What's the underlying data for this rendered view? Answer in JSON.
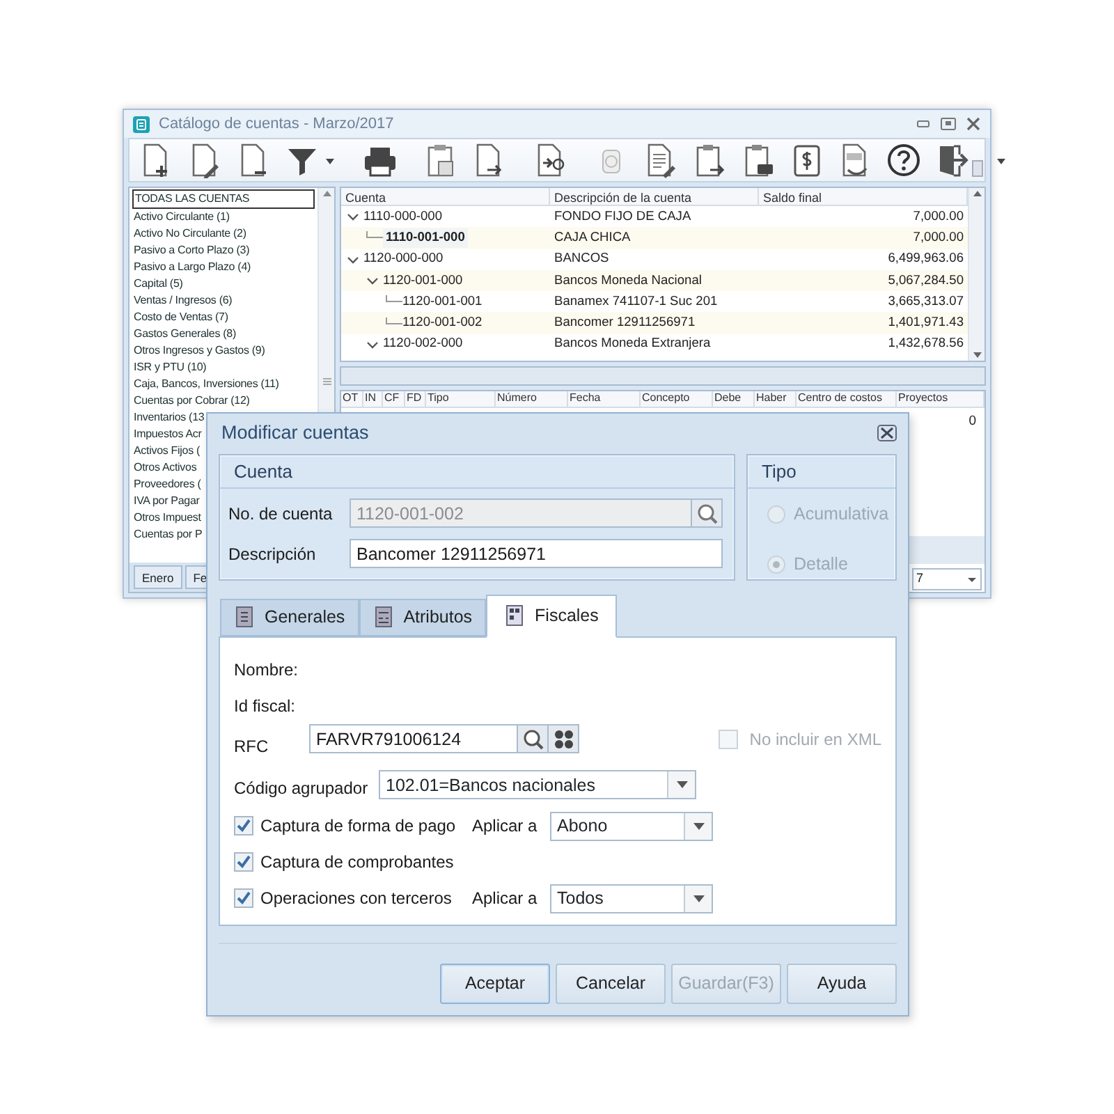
{
  "window": {
    "title": "Catálogo de cuentas - Marzo/2017"
  },
  "categories": [
    {
      "label": "TODAS LAS CUENTAS",
      "selected": true
    },
    {
      "label": "Activo Circulante (1)",
      "selected": false
    },
    {
      "label": "Activo No Circulante (2)",
      "selected": false
    },
    {
      "label": "Pasivo a Corto Plazo (3)",
      "selected": false
    },
    {
      "label": "Pasivo a Largo Plazo (4)",
      "selected": false
    },
    {
      "label": "Capital (5)",
      "selected": false
    },
    {
      "label": "Ventas / Ingresos (6)",
      "selected": false
    },
    {
      "label": "Costo de Ventas (7)",
      "selected": false
    },
    {
      "label": "Gastos Generales (8)",
      "selected": false
    },
    {
      "label": "Otros Ingresos y Gastos (9)",
      "selected": false
    },
    {
      "label": "ISR y PTU (10)",
      "selected": false
    },
    {
      "label": "Caja, Bancos, Inversiones (11)",
      "selected": false
    },
    {
      "label": "Cuentas por Cobrar (12)",
      "selected": false
    },
    {
      "label": "Inventarios (13",
      "selected": false
    },
    {
      "label": "Impuestos Acr",
      "selected": false
    },
    {
      "label": "Activos Fijos (",
      "selected": false
    },
    {
      "label": "Otros Activos",
      "selected": false
    },
    {
      "label": "Proveedores (",
      "selected": false
    },
    {
      "label": "IVA por Pagar",
      "selected": false
    },
    {
      "label": "Otros Impuest",
      "selected": false
    },
    {
      "label": "Cuentas por P",
      "selected": false
    }
  ],
  "tree": {
    "columns": [
      "Cuenta",
      "Descripción de la cuenta",
      "Saldo final"
    ],
    "rows": [
      {
        "account": "1110-000-000",
        "description": "FONDO FIJO DE CAJA",
        "balance": "7,000.00",
        "selected": false,
        "expanded": true,
        "children": [
          {
            "account": "1110-001-000",
            "description": "CAJA CHICA",
            "balance": "7,000.00",
            "selected": true
          }
        ]
      },
      {
        "account": "1120-000-000",
        "description": "BANCOS",
        "balance": "6,499,963.06",
        "selected": false,
        "expanded": true,
        "children": [
          {
            "account": "1120-001-000",
            "description": "Bancos Moneda Nacional",
            "balance": "5,067,284.50",
            "selected": false,
            "expanded": true,
            "children": [
              {
                "account": "1120-001-001",
                "description": "Banamex 741107-1 Suc 201",
                "balance": "3,665,313.07",
                "selected": false
              },
              {
                "account": "1120-001-002",
                "description": "Bancomer 12911256971",
                "balance": "1,401,971.43",
                "selected": false
              }
            ]
          },
          {
            "account": "1120-002-000",
            "description": "Bancos Moneda Extranjera",
            "balance": "1,432,678.56",
            "selected": false,
            "expanded": true
          }
        ]
      }
    ]
  },
  "ledger": {
    "columns": [
      "OT",
      "IN",
      "CF",
      "FD",
      "Tipo",
      "Número",
      "Fecha",
      "Concepto",
      "Debe",
      "Haber",
      "Centro de costos",
      "Proyectos"
    ],
    "projects_value": "0",
    "period_tabs": [
      "Enero",
      "Fe"
    ],
    "selector_value": "7"
  },
  "dialog": {
    "title": "Modificar cuentas",
    "account_group": {
      "title": "Cuenta",
      "fields": [
        {
          "label": "No. de cuenta",
          "value": "1120-001-002",
          "disabled": true,
          "lookup": true
        },
        {
          "label": "Descripción",
          "value": "Bancomer 12911256971",
          "disabled": false,
          "lookup": false
        }
      ]
    },
    "type_group": {
      "title": "Tipo",
      "disabled": true,
      "options": [
        {
          "label": "Acumulativa",
          "selected": false
        },
        {
          "label": "Detalle",
          "selected": true
        }
      ]
    },
    "tabs": [
      {
        "label": "Generales",
        "selected": false
      },
      {
        "label": "Atributos",
        "selected": false
      },
      {
        "label": "Fiscales",
        "selected": true
      }
    ],
    "fiscal": {
      "name_label": "Nombre:",
      "tax_id_label": "Id fiscal:",
      "rfc_label": "RFC",
      "rfc_value": "FARVR791006124",
      "exclude_xml": {
        "label": "No incluir en XML",
        "checked": false,
        "disabled": true
      },
      "grouping": {
        "label": "Código agrupador",
        "value": "102.01=Bancos nacionales"
      },
      "options": [
        {
          "label": "Captura de forma de pago",
          "checked": true,
          "apply_label": "Aplicar a",
          "apply_value": "Abono"
        },
        {
          "label": "Captura de comprobantes",
          "checked": true
        },
        {
          "label": "Operaciones con terceros",
          "checked": true,
          "apply_label": "Aplicar a",
          "apply_value": "Todos"
        }
      ]
    },
    "buttons": [
      {
        "label": "Aceptar",
        "disabled": false,
        "default": true
      },
      {
        "label": "Cancelar",
        "disabled": false,
        "default": false
      },
      {
        "label": "Guardar(F3)",
        "disabled": true,
        "default": false
      },
      {
        "label": "Ayuda",
        "disabled": false,
        "default": false
      }
    ]
  }
}
